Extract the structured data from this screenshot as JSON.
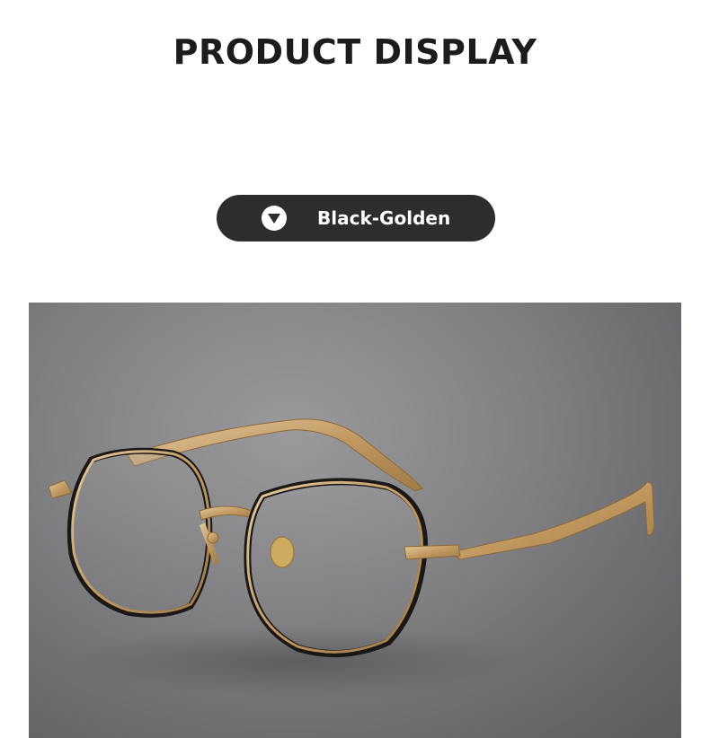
{
  "header": {
    "title": "PRODUCT DISPLAY"
  },
  "variant": {
    "label": "Black-Golden",
    "icon": "triangle-down-icon"
  },
  "colors": {
    "pill_background": "#2e2c2c",
    "frame_gold": "#c9a874",
    "frame_black": "#1a1816",
    "backdrop": "#808083"
  }
}
